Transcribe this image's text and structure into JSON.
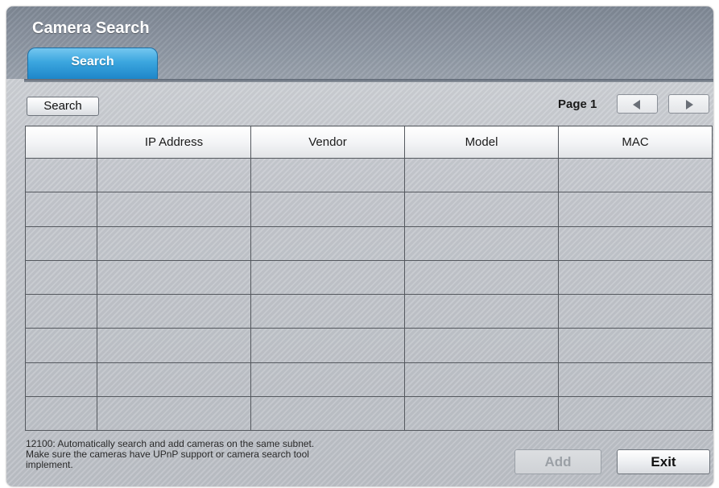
{
  "window": {
    "title": "Camera Search",
    "tabs": [
      {
        "label": "Search",
        "active": true
      }
    ]
  },
  "toolbar": {
    "search_label": "Search",
    "page_label": "Page 1",
    "prev_icon": "arrow-left-icon",
    "next_icon": "arrow-right-icon"
  },
  "table": {
    "columns": [
      "",
      "IP Address",
      "Vendor",
      "Model",
      "MAC"
    ],
    "rows": [
      [
        "",
        "",
        "",
        "",
        ""
      ],
      [
        "",
        "",
        "",
        "",
        ""
      ],
      [
        "",
        "",
        "",
        "",
        ""
      ],
      [
        "",
        "",
        "",
        "",
        ""
      ],
      [
        "",
        "",
        "",
        "",
        ""
      ],
      [
        "",
        "",
        "",
        "",
        ""
      ],
      [
        "",
        "",
        "",
        "",
        ""
      ],
      [
        "",
        "",
        "",
        "",
        ""
      ]
    ]
  },
  "footer": {
    "info_line1": "12100: Automatically search and add cameras on the same subnet.",
    "info_line2": "Make sure the cameras have UPnP support or camera search tool",
    "info_line3": "implement.",
    "add_label": "Add",
    "add_enabled": false,
    "exit_label": "Exit"
  },
  "colors": {
    "tab_active": "#3ba6df",
    "header": "#8f98a4",
    "panel": "#c4c7cd"
  }
}
